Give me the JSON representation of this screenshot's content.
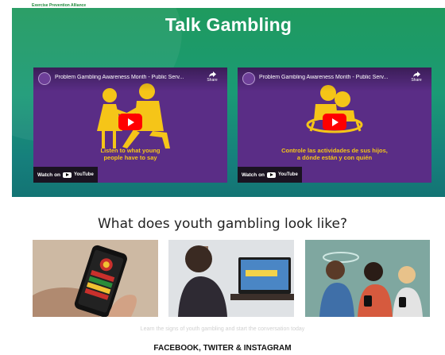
{
  "header": {
    "brand": "Exercise Prevention Alliance"
  },
  "hero": {
    "title": "Talk Gambling",
    "videos": [
      {
        "title": "Problem Gambling Awareness Month - Public Serv...",
        "share_label": "Share",
        "caption_line1": "Listen to what young",
        "caption_line2": "people have to say",
        "watch_label": "Watch on",
        "youtube_label": "YouTube"
      },
      {
        "title": "Problem Gambling Awareness Month - Public Serv...",
        "share_label": "Share",
        "caption_line1": "Controle las actividades de sus hijos,",
        "caption_line2": "a dónde están y con quién",
        "watch_label": "Watch on",
        "youtube_label": "YouTube"
      }
    ]
  },
  "youth_section": {
    "title": "What does youth gambling look like?",
    "faded_text": "Learn the signs of youth gambling and start the conversation today"
  },
  "footer": {
    "social_heading": "FACEBOOK, TWITER & INSTAGRAM"
  },
  "colors": {
    "hero_green": "#1a9a75",
    "video_purple": "#5a2d86",
    "caption_yellow": "#f5c518",
    "youtube_red": "#ff0000"
  },
  "icons": [
    "share-icon",
    "youtube-play-icon",
    "youtube-logo-icon",
    "channel-logo-icon"
  ]
}
